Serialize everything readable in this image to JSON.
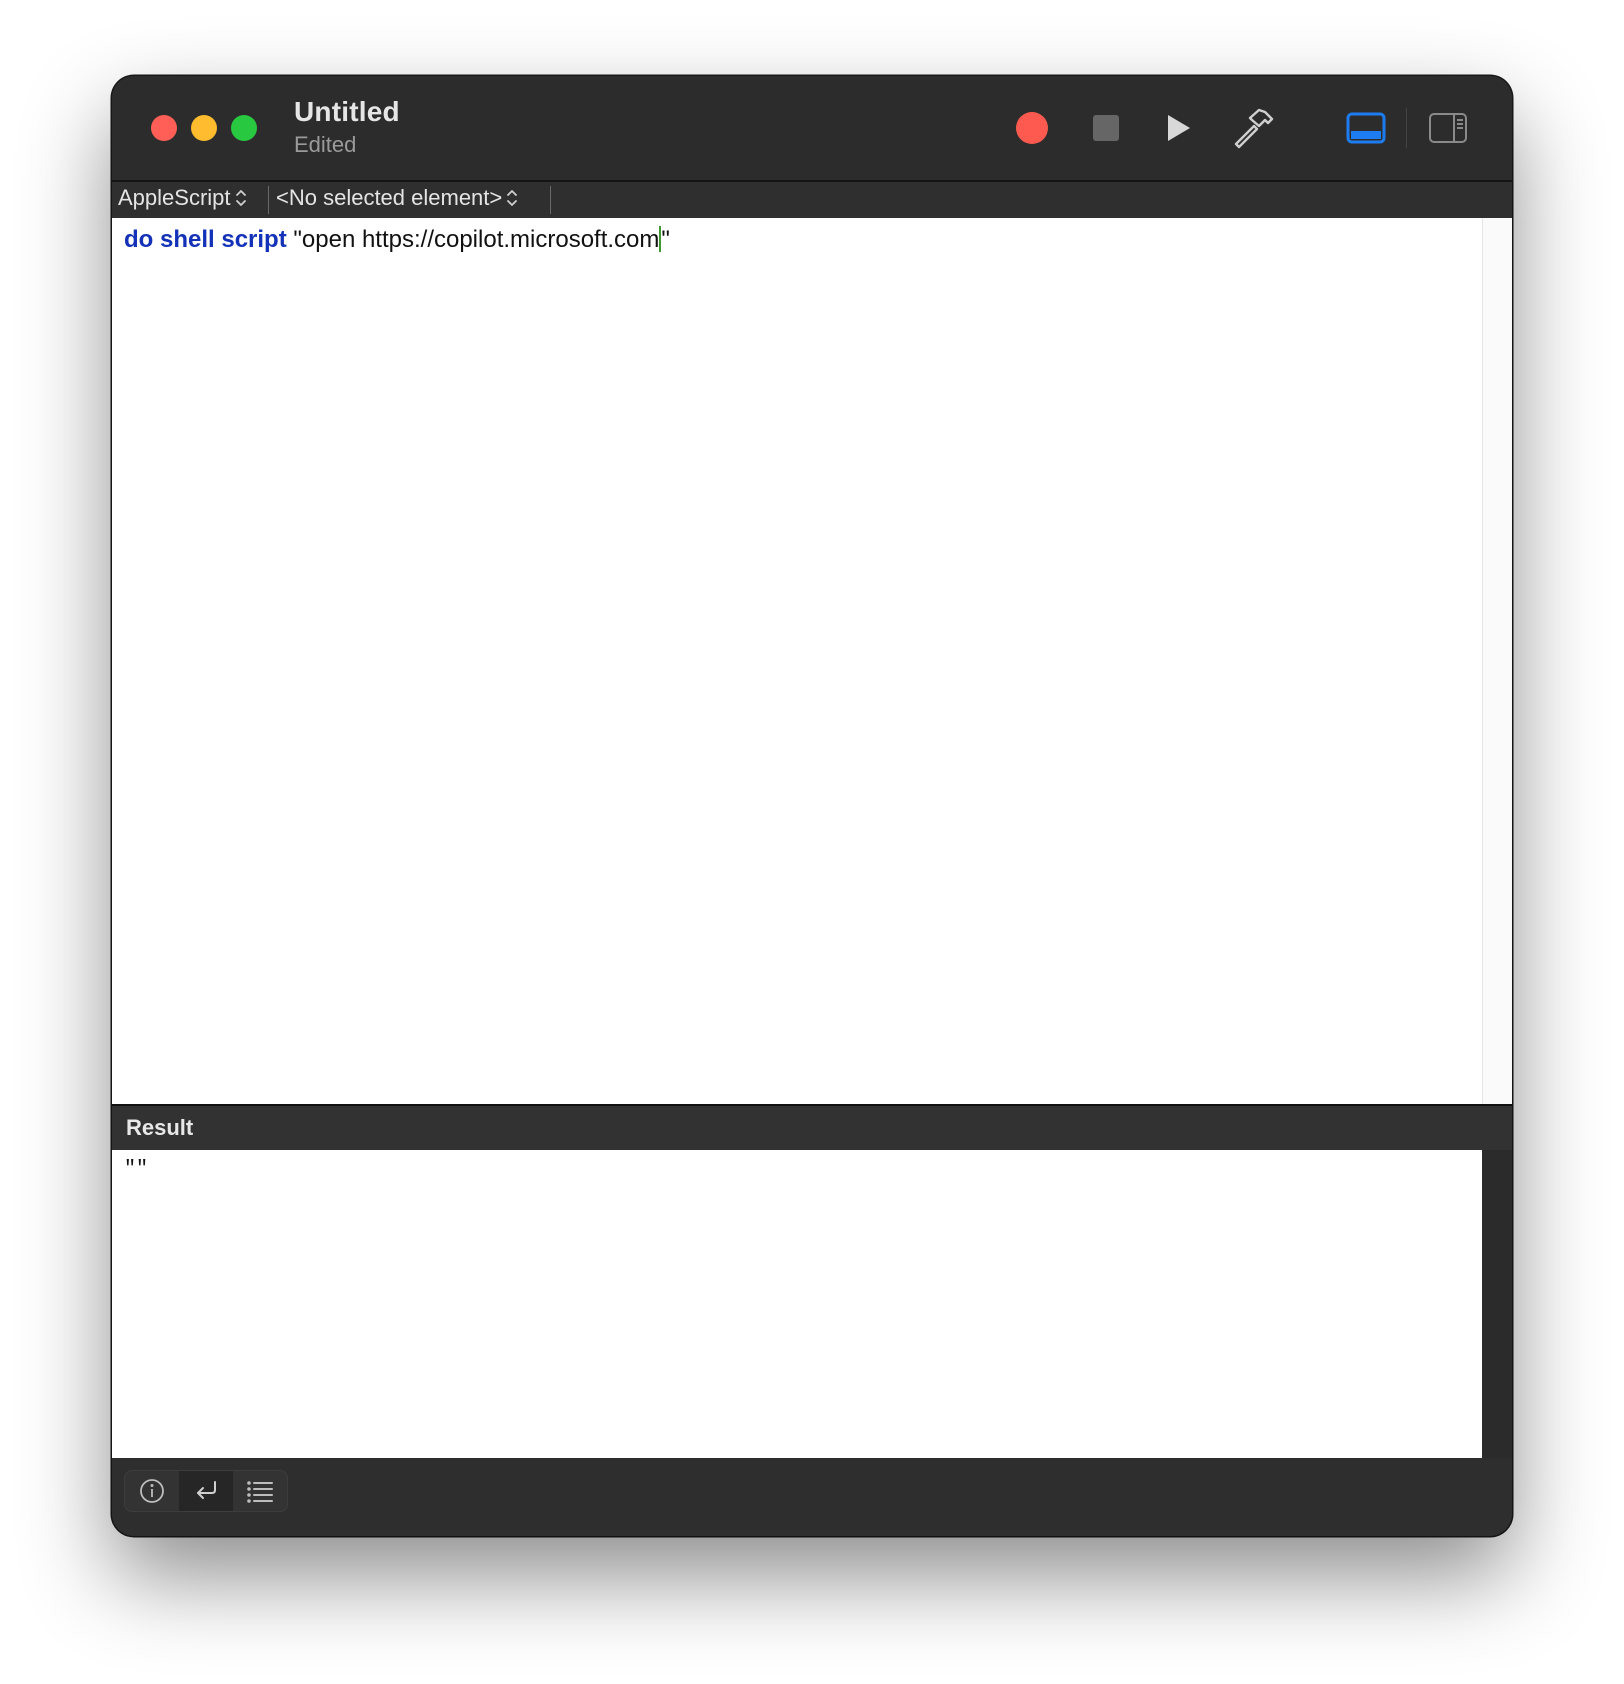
{
  "window": {
    "title": "Untitled",
    "subtitle": "Edited"
  },
  "toolbar": {
    "record_icon": "record-icon",
    "stop_icon": "stop-icon",
    "run_icon": "run-icon",
    "compile_icon": "hammer-icon",
    "view_log_icon": "bottom-panel-icon",
    "view_sidebar_icon": "right-sidebar-icon",
    "accent_color": "#1e7cf2"
  },
  "navigation": {
    "language": "AppleScript",
    "element": "<No selected element>"
  },
  "editor": {
    "keyword": "do shell script",
    "string_body": "\"open https://copilot.microsoft.com",
    "string_end": "\""
  },
  "result": {
    "label": "Result",
    "value": "\"\""
  },
  "bottom_bar": {
    "info_icon": "info-icon",
    "reply_icon": "reply-icon",
    "list_icon": "list-icon"
  }
}
